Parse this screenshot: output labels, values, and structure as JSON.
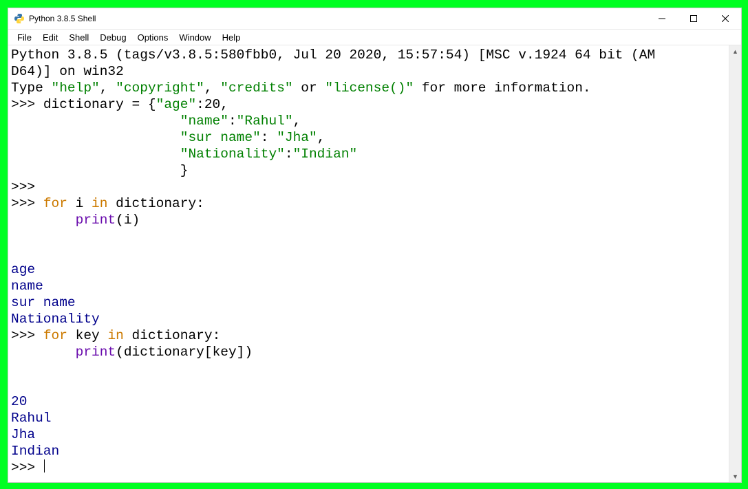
{
  "window": {
    "title": "Python 3.8.5 Shell"
  },
  "menu": {
    "file": "File",
    "edit": "Edit",
    "shell": "Shell",
    "debug": "Debug",
    "options": "Options",
    "window": "Window",
    "help": "Help"
  },
  "banner": {
    "line1": "Python 3.8.5 (tags/v3.8.5:580fbb0, Jul 20 2020, 15:57:54) [MSC v.1924 64 bit (AM",
    "line2": "D64)] on win32",
    "line3a": "Type ",
    "line3b": "\"help\"",
    "line3c": ", ",
    "line3d": "\"copyright\"",
    "line3e": ", ",
    "line3f": "\"credits\"",
    "line3g": " or ",
    "line3h": "\"license()\"",
    "line3i": " for more information."
  },
  "prompt": ">>> ",
  "code1": {
    "l1a": "dictionary = {",
    "l1b": "\"age\"",
    "l1c": ":20,",
    "l2pad": "                     ",
    "l2a": "\"name\"",
    "l2b": ":",
    "l2c": "\"Rahul\"",
    "l2d": ",",
    "l3a": "\"sur name\"",
    "l3b": ": ",
    "l3c": "\"Jha\"",
    "l3d": ",",
    "l4a": "\"Nationality\"",
    "l4b": ":",
    "l4c": "\"Indian\"",
    "l5pad": "                     ",
    "l5a": "}"
  },
  "code2": {
    "kw1": "for",
    "mid1": " i ",
    "kw2": "in",
    "rest": " dictionary:",
    "pad": "        ",
    "func": "print",
    "args": "(i)"
  },
  "out1": {
    "l1": "age",
    "l2": "name",
    "l3": "sur name",
    "l4": "Nationality"
  },
  "code3": {
    "kw1": "for",
    "mid1": " key ",
    "kw2": "in",
    "rest": " dictionary:",
    "pad": "        ",
    "func": "print",
    "args": "(dictionary[key])"
  },
  "out2": {
    "l1": "20",
    "l2": "Rahul",
    "l3": "Jha",
    "l4": "Indian"
  }
}
